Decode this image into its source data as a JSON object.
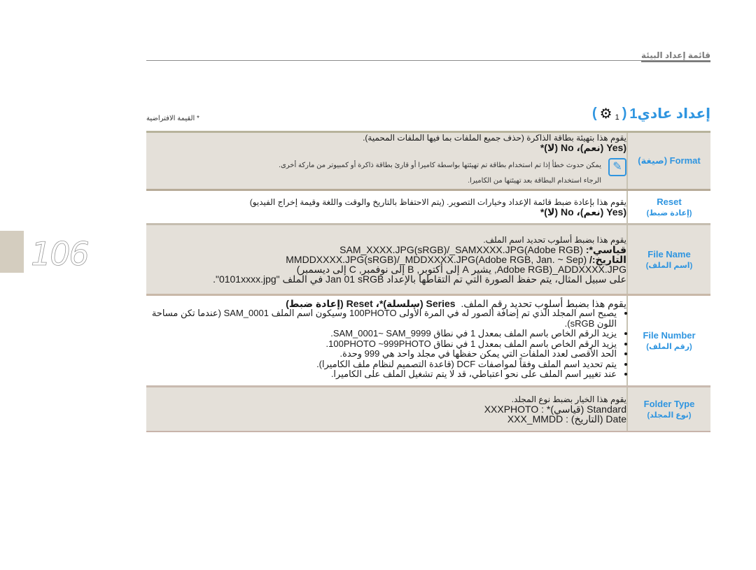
{
  "page": {
    "number": "106",
    "section_header": "قائمة إعداد البيئة",
    "title": "إعداد عادي1",
    "title_open": "(",
    "title_close": ")",
    "title_icon": "gear-icon",
    "title_icon_sub": "1",
    "default_note": "* القيمة الافتراضية",
    "accent_color": "#2f95e0"
  },
  "rows": [
    {
      "label_en": "Format",
      "label_ar": "(صيغة)",
      "desc": "يقوم هذا بتهيئة بطاقة الذاكرة (حذف جميع الملفات بما فيها الملفات المحمية).",
      "options": "(Yes (نعم)، No (لا)*",
      "note_icon": "pencil-note-icon",
      "note_lines": [
        "يمكن حدوث خطأ إذا تم استخدام بطاقة تم تهيئتها بواسطة كاميرا أو قارئ بطاقة ذاكرة أو كمبيوتر من ماركة أخرى.",
        "الرجاء استخدام البطاقة بعد تهيئتها من الكاميرا."
      ]
    },
    {
      "label_en": "Reset",
      "label_ar": "(إعادة ضبط)",
      "desc": "يقوم هذا بإعادة ضبط قائمة الإعداد وخيارات التصوير. (يتم الاحتفاظ بالتاريخ والوقت واللغة وقيمة إخراج الفيديو)",
      "options": "(Yes (نعم)، No (لا)*"
    },
    {
      "label_en": "File Name",
      "label_ar": "(اسم الملف)",
      "desc": "يقوم هذا بضبط أسلوب تحديد اسم الملف.",
      "line1_prefix": "قياسي*:",
      "line1": "SAM_XXXX.JPG(sRGB)/_SAMXXXX.JPG(Adobe RGB)",
      "line2_prefix": "التاريخ:/",
      "line2": "MMDDXXXX.JPG(sRGB)/_MDDXXXX.JPG(Adobe RGB, Jan. ~ Sep)",
      "line3": "Adobe RGB)_ADDXXXX.JPG, يشير A إلى أكتوبر, B إلى نوفمبر, C إلى ديسمبر)",
      "line4": "على سبيل المثال، يتم حفظ الصورة التي تم التقاطها بالإعداد Jan 01 sRGB في الملف \"0101xxxx.jpg\"."
    },
    {
      "label_en": "File Number",
      "label_ar": "(رقم الملف)",
      "desc": "يقوم هذا بضبط أسلوب تحديد رقم الملف.",
      "options": "Series (سلسلة)*، Reset (إعادة ضبط)",
      "bullets": [
        "يصبح اسم المجلد الذي تم إضافة الصور له في المرة الأولى 100PHOTO وسيكون اسم الملف SAM_0001 (عندما تكن مساحة اللون sRGB).",
        "يزيد الرقم الخاص باسم الملف بمعدل 1 في نطاق SAM_0001~ SAM_9999.",
        "يزيد الرقم الخاص باسم الملف بمعدل 1 في نطاق 100PHOTO ~999PHOTO.",
        "الحد الأقصى لعدد الملفات التي يمكن حفظها في مجلد واحد هي 999 وحدة.",
        "يتم تحديد اسم الملف وفقاً لمواصفات DCF (قاعدة التصميم لنظام ملف الكاميرا).",
        "عند تغيير اسم الملف على نحو اعتباطي، قد لا يتم تشغيل الملف على الكاميرا."
      ]
    },
    {
      "label_en": "Folder Type",
      "label_ar": "(نوع المجلد)",
      "desc": "يقوم هذا الخيار بضبط نوع المجلد.",
      "line1": "Standard (قياسي)* : XXXPHOTO",
      "line2": "Date (التاريخ) : XXX_MMDD"
    }
  ]
}
